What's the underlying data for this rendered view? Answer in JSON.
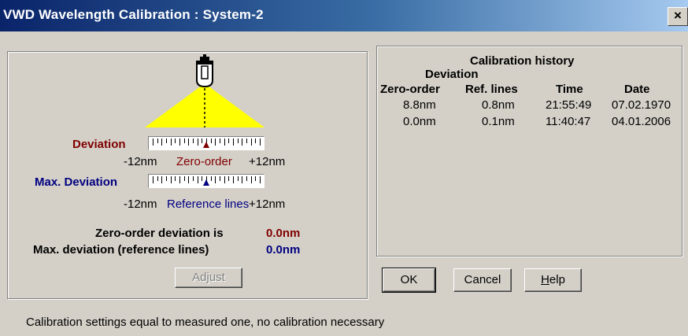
{
  "window": {
    "title": "VWD Wavelength Calibration : System-2",
    "close_glyph": "×",
    "close_icon": "close-icon"
  },
  "left": {
    "deviation_label": "Deviation",
    "deviation_min": "-12nm",
    "deviation_caption": "Zero-order",
    "deviation_max": "+12nm",
    "deviation_value": 0.0,
    "max_deviation_label": "Max. Deviation",
    "max_min": "-12nm",
    "max_caption": "Reference lines",
    "max_max": "+12nm",
    "max_value": 0.0,
    "zero_order_text": "Zero-order deviation is",
    "zero_order_value": "0.0nm",
    "max_dev_text": "Max. deviation (reference lines)",
    "max_dev_value": "0.0nm",
    "adjust_label": "Adjust",
    "lamp_icon": "lamp-icon",
    "colors": {
      "deviation": "#800000",
      "max_deviation": "#000080",
      "beam": "#ffff00"
    }
  },
  "history": {
    "title": "Calibration history",
    "group_header": "Deviation",
    "columns": [
      "Zero-order",
      "Ref. lines",
      "Time",
      "Date"
    ],
    "rows": [
      [
        "8.8nm",
        "0.8nm",
        "21:55:49",
        "07.02.1970"
      ],
      [
        "0.0nm",
        "0.1nm",
        "11:40:47",
        "04.01.2006"
      ]
    ]
  },
  "buttons": {
    "ok": "OK",
    "cancel": "Cancel",
    "help_hotkey": "H",
    "help_rest": "elp"
  },
  "status": "Calibration settings equal to measured one, no calibration necessary"
}
